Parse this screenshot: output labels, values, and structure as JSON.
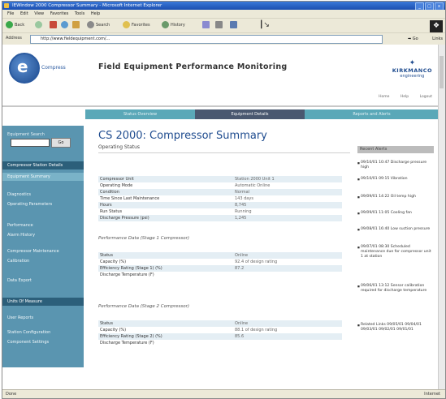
{
  "window": {
    "title": "IEWindow 2000 Compressor Summary - Microsoft Internet Explorer",
    "controls": [
      "_",
      "□",
      "x"
    ]
  },
  "menu": [
    "File",
    "Edit",
    "View",
    "Favorites",
    "Tools",
    "Help"
  ],
  "toolbar": {
    "back": "Back",
    "forward": "",
    "search": "Search",
    "favorites": "Favorites",
    "history": "History"
  },
  "address": {
    "label": "Address",
    "url": "http://www.fieldequipment.com/...",
    "go": "Go",
    "links": "Links"
  },
  "site": {
    "logo_text": "Compress",
    "title": "Field Equipment Performance Monitoring",
    "brand_name": "KIRKMANCO",
    "brand_tagline": "engineering"
  },
  "toplinks": [
    "Home",
    "Help",
    "Logout"
  ],
  "tabs": [
    "Status Overview",
    "Equipment Details",
    "Reports and Alerts"
  ],
  "sidebar": {
    "search_label": "Equipment Search",
    "go": "Go",
    "items": [
      "Compressor Station Details",
      "Equipment Summary",
      "Diagnostics",
      "Operating Parameters",
      "Performance",
      "Alarm History",
      "Compressor Maintenance",
      "Calibration",
      "Data Export",
      "Units Of Measure",
      "User Reports",
      "Station Configuration",
      "Component Settings"
    ]
  },
  "main": {
    "title": "CS 2000: Compressor Summary",
    "subtitle": "Operating Status",
    "status_rows": [
      {
        "k": "Compressor Unit",
        "v": "Station 2000 Unit 1"
      },
      {
        "k": "Operating Mode",
        "v": "Automatic Online"
      },
      {
        "k": "Condition",
        "v": "Normal"
      },
      {
        "k": "Time Since Last Maintenance",
        "v": "143 days"
      },
      {
        "k": "Hours",
        "v": "8,745"
      },
      {
        "k": "Run Status",
        "v": "Running"
      },
      {
        "k": "Discharge Pressure (psi)",
        "v": "1,245"
      }
    ],
    "section1": "Performance Data (Stage 1 Compressor)",
    "stage1_rows": [
      {
        "k": "Status",
        "v": "Online"
      },
      {
        "k": "Capacity (%)",
        "v": "92.4 of design rating"
      },
      {
        "k": "Efficiency Rating (Stage 1) (%)",
        "v": "87.2"
      },
      {
        "k": "Discharge Temperature (F)",
        "v": ""
      }
    ],
    "section2": "Performance Data (Stage 2 Compressor)",
    "stage2_rows": [
      {
        "k": "Status",
        "v": "Online"
      },
      {
        "k": "Capacity (%)",
        "v": "88.1 of design rating"
      },
      {
        "k": "Efficiency Rating (Stage 2) (%)",
        "v": "85.6"
      },
      {
        "k": "Discharge Temperature (F)",
        "v": ""
      }
    ]
  },
  "rightpanel": {
    "heading": "Recent Alerts",
    "items": [
      "09/10/01 10:47 Discharge pressure high",
      "09/10/01 09:15 Vibration",
      "09/09/01 14:22 Oil temp high",
      "09/09/01 11:05 Cooling fan",
      "09/08/01 16:40 Low suction pressure",
      "09/07/01 08:30 Scheduled maintenance due for compressor unit 1 at station",
      "09/06/01 13:12 Sensor calibration required for discharge temperature",
      "Related Links 09/05/01 09/04/01 09/03/01 09/02/01 09/01/01"
    ]
  },
  "status": {
    "text": "Done",
    "zone": "Internet"
  }
}
